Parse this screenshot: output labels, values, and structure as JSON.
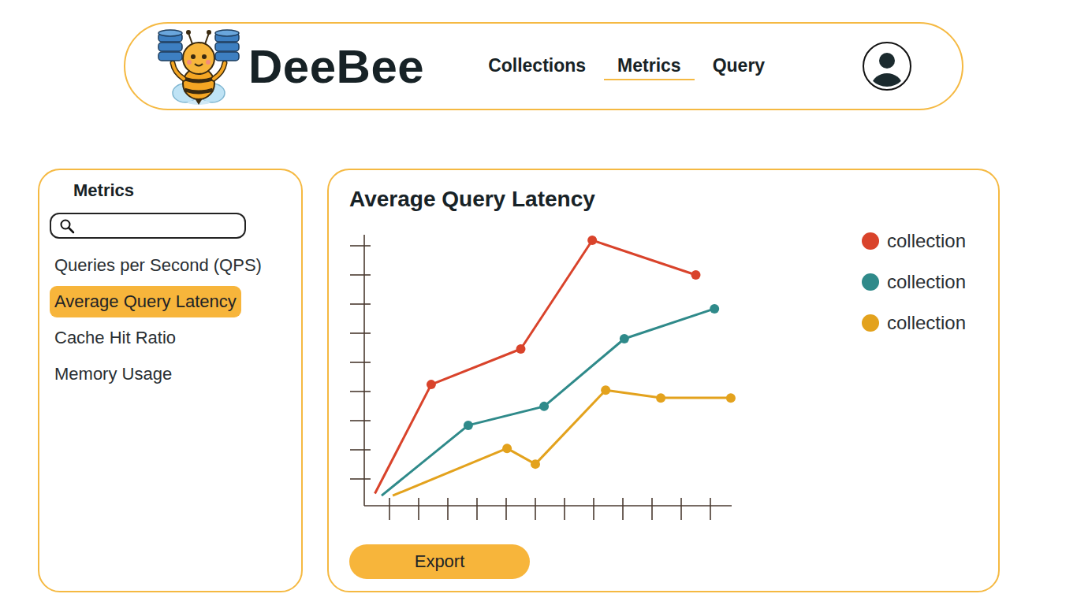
{
  "app": {
    "name": "DeeBee"
  },
  "nav": [
    {
      "label": "Collections",
      "selected": false
    },
    {
      "label": "Metrics",
      "selected": true
    },
    {
      "label": "Query",
      "selected": false
    }
  ],
  "sidebar": {
    "title": "Metrics",
    "search": {
      "placeholder": ""
    },
    "items": [
      {
        "label": "Queries per Second (QPS)",
        "selected": false
      },
      {
        "label": "Average Query Latency",
        "selected": true
      },
      {
        "label": "Cache Hit Ratio",
        "selected": false
      },
      {
        "label": "Memory Usage",
        "selected": false
      }
    ]
  },
  "chart": {
    "title": "Average Query Latency",
    "series": [
      {
        "name": "collection",
        "color": "#d9432b",
        "x": [
          0.5,
          2.43,
          5.5,
          7.95,
          11.5
        ],
        "values": [
          0.5,
          4.24,
          5.46,
          9.19,
          8.0
        ],
        "markers": [
          false,
          true,
          true,
          true,
          true
        ]
      },
      {
        "name": "collection",
        "color": "#2f8a8a",
        "x": [
          0.73,
          3.7,
          6.3,
          9.05,
          12.14
        ],
        "values": [
          0.43,
          2.84,
          3.49,
          5.81,
          6.84
        ],
        "markers": [
          false,
          true,
          true,
          true,
          true
        ]
      },
      {
        "name": "collection",
        "color": "#e3a21d",
        "x": [
          1.11,
          5.03,
          6.0,
          8.41,
          10.3,
          12.7
        ],
        "values": [
          0.43,
          2.05,
          1.51,
          4.05,
          3.78,
          3.78
        ],
        "markers": [
          false,
          true,
          true,
          true,
          true,
          true
        ]
      }
    ]
  },
  "buttons": [
    {
      "label": "Export"
    }
  ]
}
